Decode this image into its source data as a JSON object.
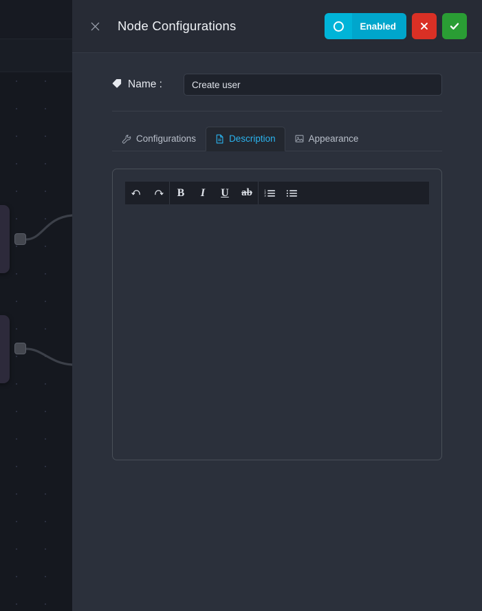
{
  "window": {
    "background_color": "#15181f",
    "panel_color": "#2b303b"
  },
  "canvas": {
    "name": "workflow-canvas",
    "node_color": "#2d2a3b",
    "dot_color": "#2c3040",
    "edge_color": "#3c4049",
    "nodes": [
      {
        "id": "node-1",
        "handle": "output-handle"
      },
      {
        "id": "node-2",
        "handle": "output-handle"
      }
    ]
  },
  "header": {
    "title": "Node Configurations",
    "close_icon": "close-icon",
    "toggle": {
      "label": "Enabled",
      "state": "on",
      "color": "#00a6cc",
      "knob_color": "#00b4d8"
    },
    "cancel": {
      "icon": "x-icon",
      "color": "#d93025"
    },
    "confirm": {
      "icon": "check-icon",
      "color": "#2a9d34"
    }
  },
  "name_field": {
    "label": "Name :",
    "icon": "tag-icon",
    "value": "Create user",
    "placeholder": "Name"
  },
  "tabs": {
    "active": "Description",
    "items": [
      {
        "label": "Configurations",
        "icon": "wrench-icon",
        "active": false
      },
      {
        "label": "Description",
        "icon": "document-icon",
        "active": true
      },
      {
        "label": "Appearance",
        "icon": "image-icon",
        "active": false
      }
    ],
    "active_color": "#2bb3ee"
  },
  "editor": {
    "name": "description-rich-text-editor",
    "content": "",
    "placeholder": "",
    "toolbar_groups": [
      {
        "name": "history",
        "buttons": [
          {
            "name": "undo-icon",
            "label": "↶",
            "type": "icon"
          },
          {
            "name": "redo-icon",
            "label": "↷",
            "type": "icon"
          }
        ]
      },
      {
        "name": "text-format",
        "buttons": [
          {
            "name": "bold-button",
            "label": "B",
            "type": "bold"
          },
          {
            "name": "italic-button",
            "label": "I",
            "type": "italic"
          },
          {
            "name": "underline-button",
            "label": "U",
            "type": "under"
          },
          {
            "name": "strikethrough-button",
            "label": "ab",
            "type": "strike"
          }
        ]
      },
      {
        "name": "lists",
        "buttons": [
          {
            "name": "ordered-list-icon",
            "label": "",
            "type": "ol"
          },
          {
            "name": "unordered-list-icon",
            "label": "",
            "type": "ul"
          }
        ]
      }
    ]
  }
}
